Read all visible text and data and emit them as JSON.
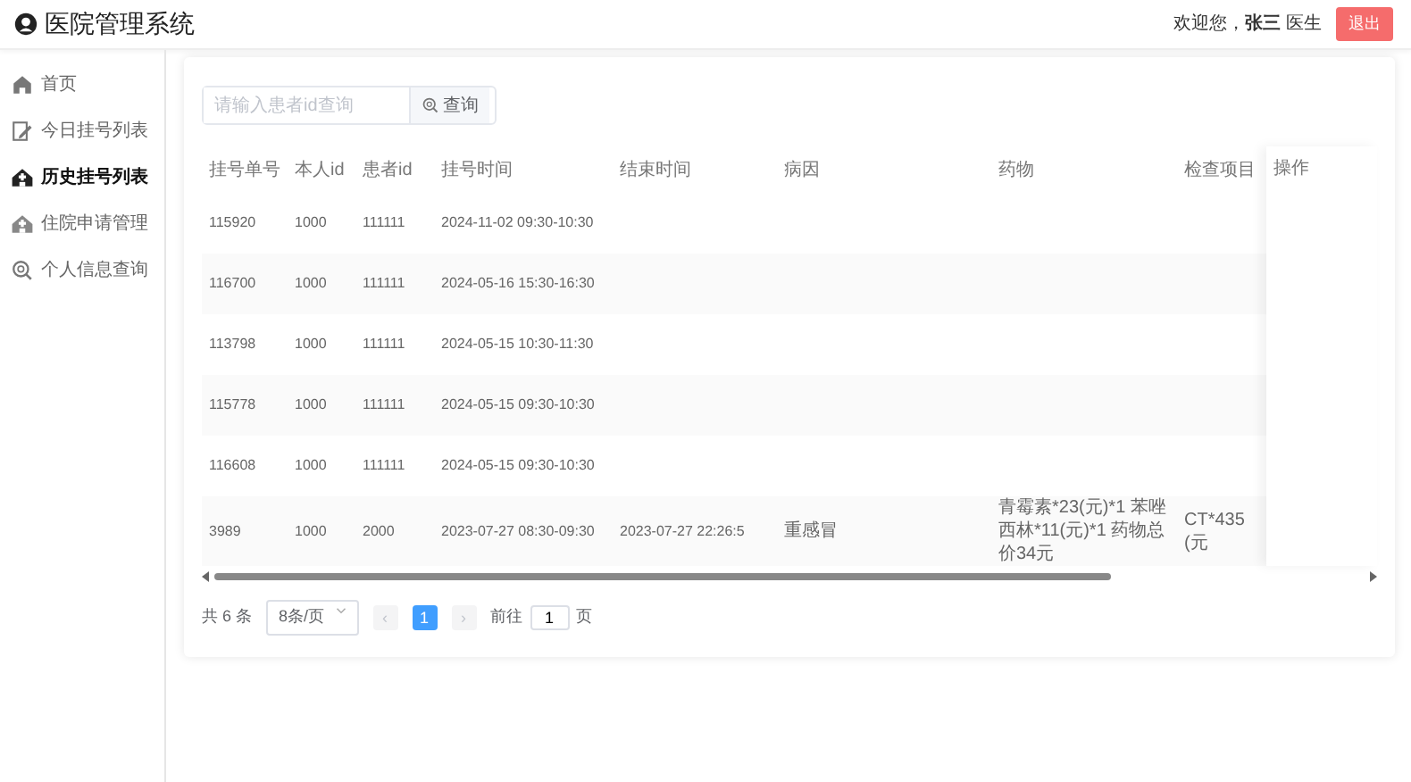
{
  "header": {
    "title": "医院管理系统",
    "welcome": "欢迎您，**张三** 医生",
    "logout": "退出"
  },
  "sidebar": {
    "items": [
      {
        "label": "首页",
        "selected": false
      },
      {
        "label": "今日挂号列表",
        "selected": false
      },
      {
        "label": "历史挂号列表",
        "selected": true
      },
      {
        "label": "住院申请管理",
        "selected": false
      },
      {
        "label": "个人信息查询",
        "selected": false
      }
    ]
  },
  "search": {
    "placeholder": "请输入患者id查询",
    "button": "查询"
  },
  "table": {
    "columns": [
      "挂号单号",
      "本人id",
      "患者id",
      "挂号时间",
      "结束时间",
      "病因",
      "药物",
      "检查项目",
      "操作"
    ],
    "rows": [
      [
        "115920",
        "1000",
        "111111",
        "2024-11-02 09:30-10:30",
        "",
        "",
        "",
        "",
        ""
      ],
      [
        "116700",
        "1000",
        "111111",
        "2024-05-16 15:30-16:30",
        "",
        "",
        "",
        "",
        ""
      ],
      [
        "113798",
        "1000",
        "111111",
        "2024-05-15 10:30-11:30",
        "",
        "",
        "",
        "",
        ""
      ],
      [
        "115778",
        "1000",
        "111111",
        "2024-05-15 09:30-10:30",
        "",
        "",
        "",
        "",
        ""
      ],
      [
        "116608",
        "1000",
        "111111",
        "2024-05-15 09:30-10:30",
        "",
        "",
        "",
        "",
        ""
      ],
      [
        "3989",
        "1000",
        "2000",
        "2023-07-27 08:30-09:30",
        "2023-07-27 22:26:5",
        "重感冒",
        "青霉素*23(元)*1 苯唑西林*11(元)*1 药物总价34元",
        "CT*435(元",
        ""
      ]
    ]
  },
  "pagination": {
    "total": "共 6 条",
    "page_size": "8条/页",
    "prev": "‹",
    "pages": [
      {
        "label": "1",
        "selected": true
      }
    ],
    "next": "›",
    "goto": "前往",
    "goto_value": "1",
    "goto_suffix": "页"
  }
}
